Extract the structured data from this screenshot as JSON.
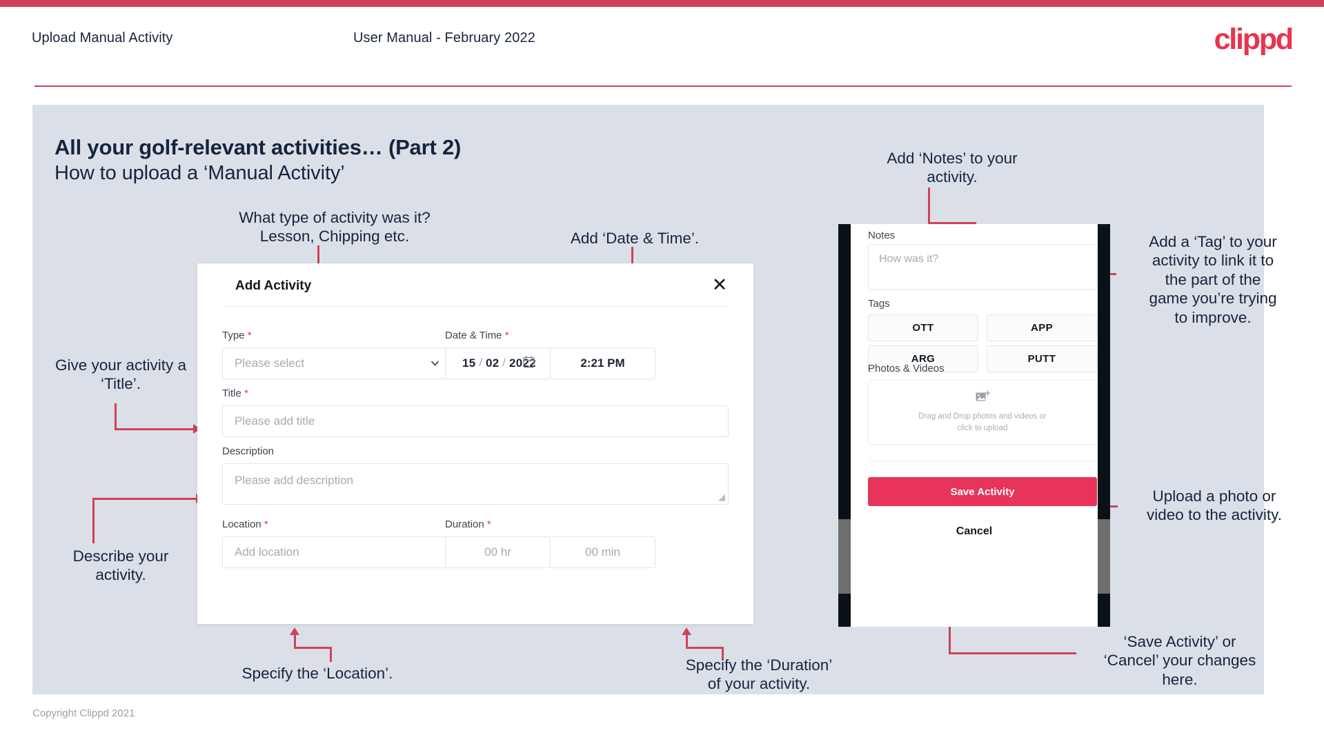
{
  "header": {
    "title": "Upload Manual Activity",
    "subtitle": "User Manual - February 2022",
    "brand": "clippd"
  },
  "slide": {
    "title": "All your golf-relevant activities… (Part 2)",
    "subtitle": "How to upload a ‘Manual Activity’"
  },
  "annotations": {
    "type": "What type of activity was it?\nLesson, Chipping etc.",
    "date_time": "Add ‘Date & Time’.",
    "title": "Give your activity a\n‘Title’.",
    "description": "Describe your\nactivity.",
    "location": "Specify the ‘Location’.",
    "duration": "Specify the ‘Duration’\nof your activity.",
    "notes": "Add ‘Notes’ to your\nactivity.",
    "tags": "Add a ‘Tag’ to your\nactivity to link it to\nthe part of the\ngame you’re trying\nto improve.",
    "upload": "Upload a photo or\nvideo to the activity.",
    "save_cancel": "‘Save Activity’ or\n‘Cancel’ your changes\nhere."
  },
  "dialog": {
    "title": "Add Activity",
    "close_label": "✕",
    "fields": {
      "type": {
        "label": "Type",
        "required": "*",
        "placeholder": "Please select"
      },
      "date_time": {
        "label": "Date & Time",
        "required": "*",
        "day": "15",
        "month": "02",
        "year": "2022",
        "sep": "/",
        "time": "2:21 PM"
      },
      "title": {
        "label": "Title",
        "required": "*",
        "placeholder": "Please add title"
      },
      "description": {
        "label": "Description",
        "required": "",
        "placeholder": "Please add description"
      },
      "location": {
        "label": "Location",
        "required": "*",
        "placeholder": "Add location"
      },
      "duration": {
        "label": "Duration",
        "required": "*",
        "hours_placeholder": "00 hr",
        "minutes_placeholder": "00 min"
      }
    }
  },
  "phone": {
    "notes_label": "Notes",
    "notes_placeholder": "How was it?",
    "tags_label": "Tags",
    "tags": [
      "OTT",
      "APP",
      "ARG",
      "PUTT"
    ],
    "photos_label": "Photos & Videos",
    "upload_text": "Drag and Drop photos and videos or\nclick to upload",
    "save_label": "Save Activity",
    "cancel_label": "Cancel"
  },
  "footer": {
    "copyright": "Copyright Clippd 2021"
  },
  "colors": {
    "accent": "#cf4257",
    "brand": "#e8344e",
    "save": "#e8345a",
    "panel": "#dbe0e8",
    "text": "#16243c"
  }
}
